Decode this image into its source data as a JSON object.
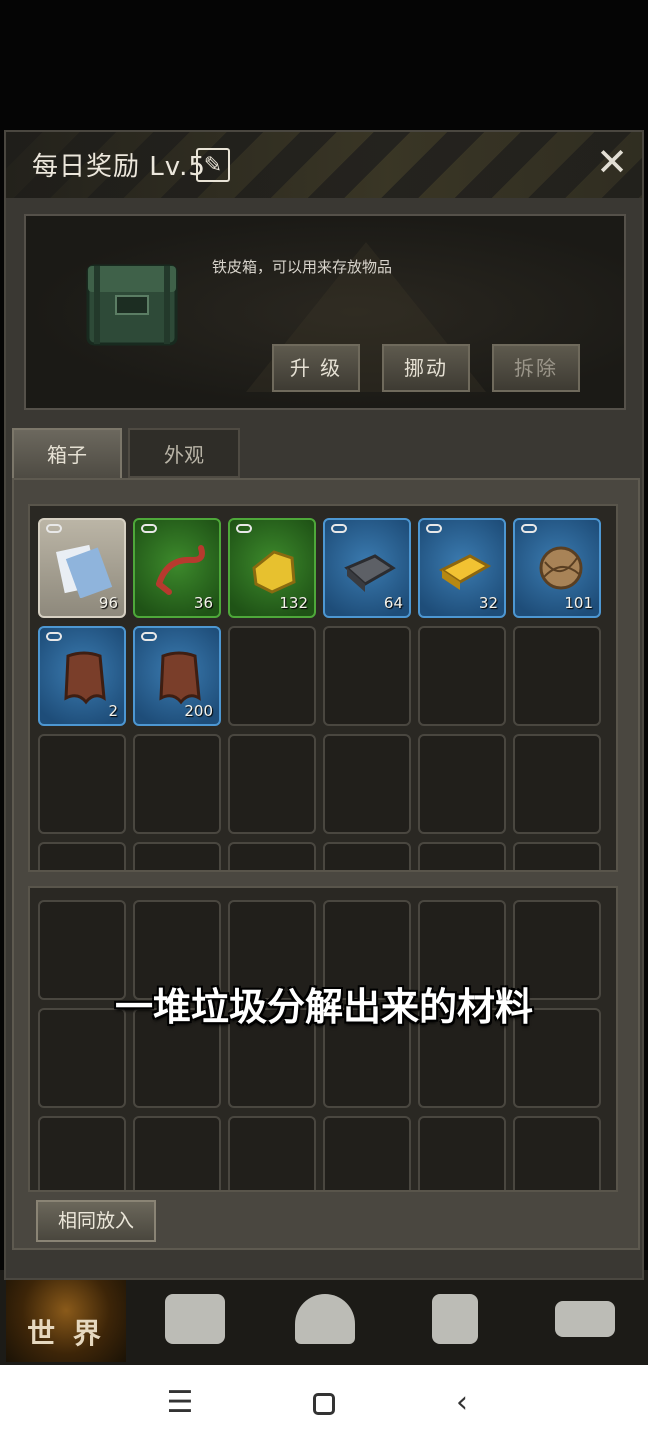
{
  "dialog": {
    "title": "每日奖励 Lv.5",
    "close_icon": "close-icon",
    "edit_icon": "pencil-icon"
  },
  "info": {
    "description": "铁皮箱，可以用来存放物品",
    "buttons": {
      "upgrade": "升 级",
      "move": "挪动",
      "demolish": "拆除"
    }
  },
  "tabs": [
    {
      "label": "箱子",
      "active": true
    },
    {
      "label": "外观",
      "active": false
    }
  ],
  "items": [
    {
      "name": "paper",
      "rarity": "grey",
      "count": "96"
    },
    {
      "name": "hook",
      "rarity": "green",
      "count": "36"
    },
    {
      "name": "gold-ore",
      "rarity": "green",
      "count": "132"
    },
    {
      "name": "iron-ingot",
      "rarity": "blue",
      "count": "64"
    },
    {
      "name": "gold-ingot",
      "rarity": "blue",
      "count": "32"
    },
    {
      "name": "rope-ball",
      "rarity": "blue",
      "count": "101"
    },
    {
      "name": "leather",
      "rarity": "blue",
      "count": "2"
    },
    {
      "name": "leather",
      "rarity": "blue",
      "count": "200"
    }
  ],
  "same_put_label": "相同放入",
  "subtitle": "一堆垃圾分解出来的材料",
  "bottom_nav": {
    "world_label": "世 界"
  },
  "colors": {
    "grey_rarity": "#a8a294",
    "green_rarity": "#2f7a22",
    "blue_rarity": "#2b6396"
  }
}
